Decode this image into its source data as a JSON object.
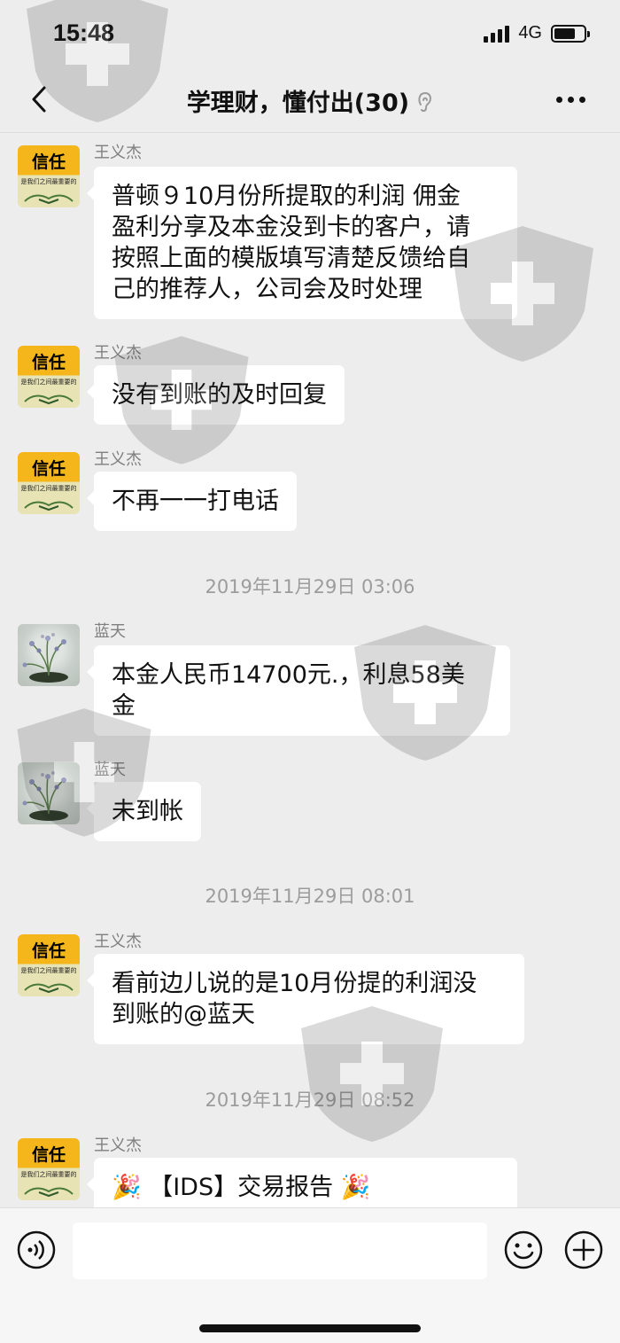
{
  "status_bar": {
    "time": "15:48",
    "network": "4G"
  },
  "nav": {
    "title": "学理财，懂付出(30)"
  },
  "messages": [
    {
      "sender": "王义杰",
      "avatar": "trust",
      "avatar_text": "信任",
      "avatar_subtext": "是我们之间最重要的",
      "text_lines": [
        "普顿９10月份所提取的利润 佣金",
        "盈利分享及本金没到卡的客户，请",
        "按照上面的模版填写清楚反馈给自",
        "己的推荐人，公司会及时处理"
      ]
    },
    {
      "sender": "王义杰",
      "avatar": "trust",
      "avatar_text": "信任",
      "avatar_subtext": "是我们之间最重要的",
      "text_lines": [
        "没有到账的及时回复"
      ]
    },
    {
      "sender": "王义杰",
      "avatar": "trust",
      "avatar_text": "信任",
      "avatar_subtext": "是我们之间最重要的",
      "text_lines": [
        "不再一一打电话"
      ]
    },
    {
      "sender": "蓝天",
      "avatar": "flower",
      "text_lines": [
        "本金人民币14700元.，利息58美",
        "金"
      ]
    },
    {
      "sender": "蓝天",
      "avatar": "flower",
      "text_lines": [
        "未到帐"
      ]
    },
    {
      "sender": "王义杰",
      "avatar": "trust",
      "avatar_text": "信任",
      "avatar_subtext": "是我们之间最重要的",
      "text_lines": [
        "看前边儿说的是10月份提的利润没",
        "到账的@蓝天"
      ]
    },
    {
      "sender": "王义杰",
      "avatar": "trust",
      "avatar_text": "信任",
      "avatar_subtext": "是我们之间最重要的",
      "text_lines": [
        "🎉 【IDS】交易报告 🎉"
      ]
    }
  ],
  "timestamps": [
    "2019年11月29日 03:06",
    "2019年11月29日 08:01",
    "2019年11月29日 08:52"
  ],
  "colors": {
    "background": "#ededed",
    "bubble": "#ffffff",
    "avatar_trust": "#f5b61c",
    "meta_text": "#9c9c9c"
  }
}
